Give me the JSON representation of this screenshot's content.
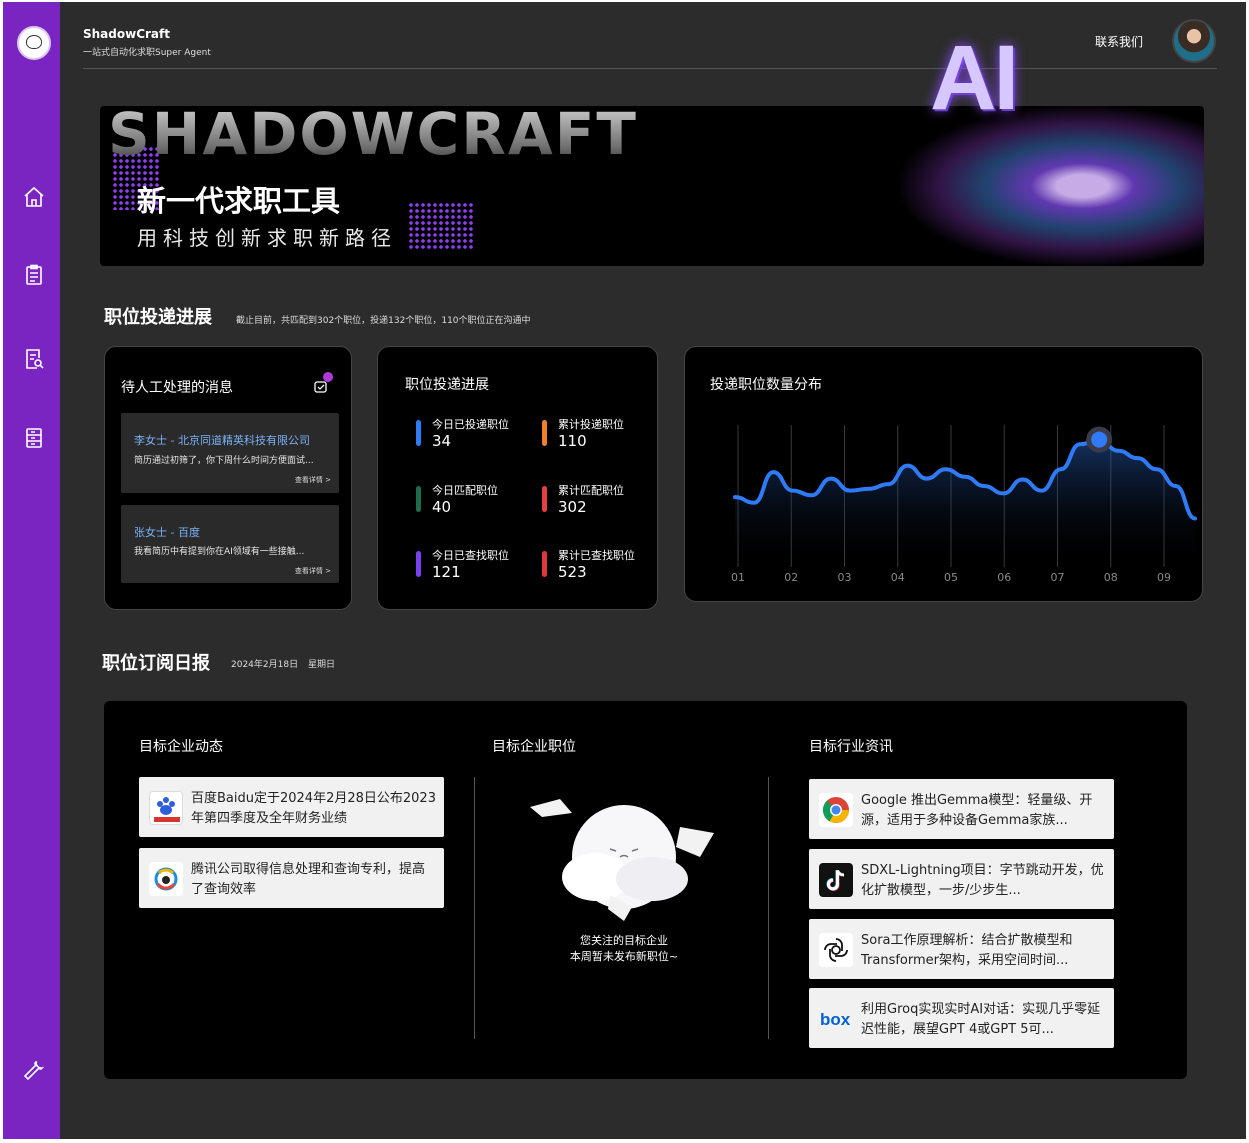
{
  "app": {
    "name": "ShadowCraft",
    "tagline": "一站式自动化求职Super Agent",
    "contact_label": "联系我们"
  },
  "sidebar": {
    "items": [
      {
        "icon": "home-icon"
      },
      {
        "icon": "clipboard-icon"
      },
      {
        "icon": "resume-search-icon"
      },
      {
        "icon": "document-list-icon"
      },
      {
        "icon": "wrench-icon"
      }
    ],
    "color": "#7a25c2"
  },
  "banner": {
    "brand_text": "SHADOWCRAFT",
    "title": "新一代求职工具",
    "subtitle": "用科技创新求职新路径",
    "art_text": "AI"
  },
  "progress_section": {
    "title": "职位投递进展",
    "note": "截止目前，共匹配到302个职位，投递132个职位，110个职位正在沟通中"
  },
  "messages_card": {
    "title": "待人工处理的消息",
    "items": [
      {
        "from": "李女士 - 北京同道精英科技有限公司",
        "preview": "简历通过初筛了，你下周什么时间方便面试...",
        "more": "查看详情 >"
      },
      {
        "from": "张女士 - 百度",
        "preview": "我看简历中有提到你在AI领域有一些接触...",
        "more": "查看详情 >"
      }
    ]
  },
  "stats_card": {
    "title": "职位投递进展",
    "stats": [
      {
        "label": "今日已投递职位",
        "value": "34",
        "color": "#2f7bf5"
      },
      {
        "label": "累计投递职位",
        "value": "110",
        "color": "#f0802a"
      },
      {
        "label": "今日匹配职位",
        "value": "40",
        "color": "#1e6b4f"
      },
      {
        "label": "累计匹配职位",
        "value": "302",
        "color": "#e54040"
      },
      {
        "label": "今日已查找职位",
        "value": "121",
        "color": "#7a3ff0"
      },
      {
        "label": "累计已查找职位",
        "value": "523",
        "color": "#e03838"
      }
    ]
  },
  "chart_card": {
    "title": "投递职位数量分布"
  },
  "chart_data": {
    "type": "line",
    "title": "投递职位数量分布",
    "categories": [
      "01",
      "02",
      "03",
      "04",
      "05",
      "06",
      "07",
      "08",
      "09"
    ],
    "values": [
      58,
      52,
      85,
      65,
      60,
      78,
      65,
      67,
      72,
      92,
      78,
      88,
      80,
      70,
      62,
      77,
      65,
      88,
      115,
      120,
      108,
      100,
      88,
      70,
      35
    ],
    "highlight_index": 7,
    "color": "#2f7bf5",
    "grid": true
  },
  "daily_section": {
    "title": "职位订阅日报",
    "date": "2024年2月18日",
    "weekday": "星期日"
  },
  "report": {
    "companies_title": "目标企业动态",
    "companies": [
      {
        "icon": "baidu-logo-icon",
        "text": "百度Baidu定于2024年2月28日公布2023年第四季度及全年财务业绩"
      },
      {
        "icon": "tencent-logo-icon",
        "text": "腾讯公司取得信息处理和查询专利，提高了查询效率"
      }
    ],
    "jobs_title": "目标企业职位",
    "jobs_empty_line1": "您关注的目标企业",
    "jobs_empty_line2": "本周暂未发布新职位~",
    "industry_title": "目标行业资讯",
    "industry": [
      {
        "icon": "chrome-logo-icon",
        "text": "Google 推出Gemma模型：轻量级、开源，适用于多种设备Gemma家族..."
      },
      {
        "icon": "tiktok-logo-icon",
        "text": "SDXL-Lightning项目：字节跳动开发，优化扩散模型，一步/少步生..."
      },
      {
        "icon": "openai-logo-icon",
        "text": "Sora工作原理解析：结合扩散模型和Transformer架构，采用空间时间..."
      },
      {
        "icon": "box-logo-icon",
        "text": "利用Groq实现实时AI对话：实现几乎零延迟性能，展望GPT 4或GPT 5可..."
      }
    ]
  }
}
